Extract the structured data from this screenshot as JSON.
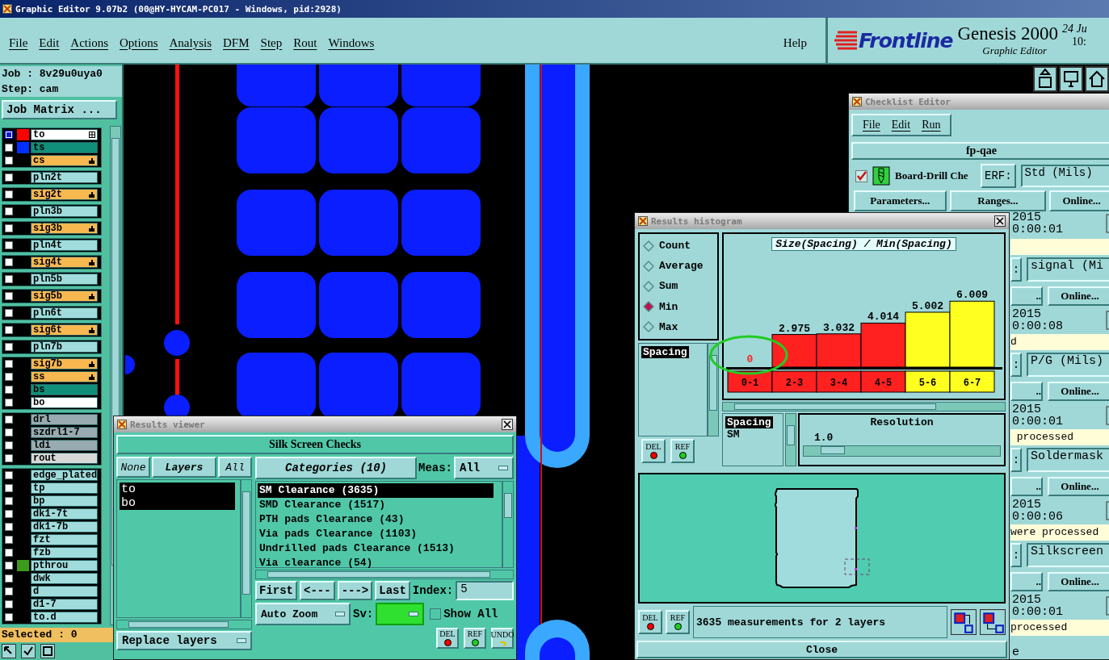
{
  "window": {
    "title": "Graphic Editor 9.07b2 (00@HY-HYCAM-PC017 - Windows, pid:2928)"
  },
  "menu": [
    "File",
    "Edit",
    "Actions",
    "Options",
    "Analysis",
    "DFM",
    "Step",
    "Rout",
    "Windows"
  ],
  "help": "Help",
  "brand": {
    "logo": "Frontline",
    "product": "Genesis 2000",
    "subtitle": "Graphic Editor",
    "date": "24 Ju",
    "time": "10:"
  },
  "job": {
    "job": "Job : 8v29u0uya0",
    "step": "Step: cam",
    "matrix_button": "Job Matrix ..."
  },
  "layer_groups": [
    {
      "layers": [
        {
          "name": "to",
          "color": "#ffffff",
          "swatch": {
            "color": "#ff0000"
          },
          "selected": true,
          "kind": "grid"
        },
        {
          "name": "ts",
          "color": "#10907a",
          "swatch": {
            "color": "#0030ff"
          },
          "selected": false,
          "kind": "plain"
        },
        {
          "name": "cs",
          "color": "#f8b850",
          "selected": false,
          "kind": "hand"
        }
      ]
    },
    {
      "layers": [
        {
          "name": "pln2t",
          "color": "#a0dcdc",
          "selected": false,
          "kind": "plain"
        }
      ]
    },
    {
      "layers": [
        {
          "name": "sig2t",
          "color": "#f8b850",
          "selected": false,
          "kind": "hand"
        }
      ]
    },
    {
      "layers": [
        {
          "name": "pln3b",
          "color": "#a0dcdc",
          "selected": false,
          "kind": "plain"
        }
      ]
    },
    {
      "layers": [
        {
          "name": "sig3b",
          "color": "#f8b850",
          "selected": false,
          "kind": "hand"
        }
      ]
    },
    {
      "layers": [
        {
          "name": "pln4t",
          "color": "#a0dcdc",
          "selected": false,
          "kind": "plain"
        }
      ]
    },
    {
      "layers": [
        {
          "name": "sig4t",
          "color": "#f8b850",
          "selected": false,
          "kind": "hand"
        }
      ]
    },
    {
      "layers": [
        {
          "name": "pln5b",
          "color": "#a0dcdc",
          "selected": false,
          "kind": "plain"
        }
      ]
    },
    {
      "layers": [
        {
          "name": "sig5b",
          "color": "#f8b850",
          "selected": false,
          "kind": "hand"
        }
      ]
    },
    {
      "layers": [
        {
          "name": "pln6t",
          "color": "#a0dcdc",
          "selected": false,
          "kind": "plain"
        }
      ]
    },
    {
      "layers": [
        {
          "name": "sig6t",
          "color": "#f8b850",
          "selected": false,
          "kind": "hand"
        }
      ]
    },
    {
      "layers": [
        {
          "name": "pln7b",
          "color": "#a0dcdc",
          "selected": false,
          "kind": "plain"
        }
      ]
    },
    {
      "layers": [
        {
          "name": "sig7b",
          "color": "#f8b850",
          "selected": false,
          "kind": "hand"
        },
        {
          "name": "ss",
          "color": "#f8b850",
          "selected": false,
          "kind": "hand"
        },
        {
          "name": "bs",
          "color": "#10907a",
          "selected": false,
          "kind": "plain"
        },
        {
          "name": "bo",
          "color": "#ffffff",
          "selected": false,
          "kind": "plain"
        }
      ]
    },
    {
      "layers": [
        {
          "name": "drl",
          "color": "#98abb0",
          "selected": false,
          "kind": "plain"
        },
        {
          "name": "szdrl1-7",
          "color": "#98abb0",
          "selected": false,
          "kind": "plain"
        },
        {
          "name": "ldi",
          "color": "#98abb0",
          "selected": false,
          "kind": "plain"
        },
        {
          "name": "rout",
          "color": "#d8d8d8",
          "selected": false,
          "kind": "plain"
        }
      ]
    },
    {
      "layers": [
        {
          "name": "edge_plated",
          "color": "#a0dcdc",
          "selected": false,
          "kind": "plain"
        },
        {
          "name": "tp",
          "color": "#a0dcdc",
          "selected": false,
          "kind": "plain"
        },
        {
          "name": "bp",
          "color": "#a0dcdc",
          "selected": false,
          "kind": "plain"
        },
        {
          "name": "dk1-7t",
          "color": "#a0dcdc",
          "selected": false,
          "kind": "plain"
        },
        {
          "name": "dk1-7b",
          "color": "#a0dcdc",
          "selected": false,
          "kind": "plain"
        },
        {
          "name": "fzt",
          "color": "#a0dcdc",
          "selected": false,
          "kind": "plain"
        },
        {
          "name": "fzb",
          "color": "#a0dcdc",
          "selected": false,
          "kind": "plain"
        },
        {
          "name": "pthrou",
          "color": "#a0dcdc",
          "swatch": {
            "color": "#3c9a1c"
          },
          "selected": false,
          "kind": "plain"
        },
        {
          "name": "dwk",
          "color": "#a0dcdc",
          "selected": false,
          "kind": "plain"
        },
        {
          "name": "d",
          "color": "#a0dcdc",
          "selected": false,
          "kind": "plain"
        },
        {
          "name": "d1-7",
          "color": "#a0dcdc",
          "selected": false,
          "kind": "plain"
        },
        {
          "name": "to.d",
          "color": "#a0dcdc",
          "selected": false,
          "kind": "plain"
        }
      ]
    }
  ],
  "selected_count": "Selected : 0",
  "checklist": {
    "title": "Checklist Editor",
    "menu": [
      "File",
      "Edit",
      "Run"
    ],
    "name": "fp-qae",
    "check": {
      "checked": true,
      "name": "Board-Drill Che",
      "erf": "ERF:",
      "field": "Std (Mils)"
    },
    "buttons": [
      "Parameters...",
      "Ranges...",
      "Online..."
    ],
    "first_run": {
      "year": "2015",
      "time": "0:00:01"
    },
    "sections": [
      {
        "erf": ":",
        "field": "signal (Mi",
        "ranges": "..",
        "online": "Online...",
        "year": "2015",
        "time": "0:00:08",
        "status": "d"
      },
      {
        "erf": ":",
        "field": "P/G (Mils)",
        "ranges": "..",
        "online": "Online...",
        "year": "2015",
        "time": "0:00:01",
        "status": " processed"
      },
      {
        "erf": ":",
        "field": "Soldermask",
        "ranges": "..",
        "online": "Online...",
        "year": "2015",
        "time": "0:00:06",
        "status": "were processed"
      },
      {
        "erf": ":",
        "field": "Silkscreen",
        "ranges": "..",
        "online": "Online...",
        "year": "2015",
        "time": "0:00:01",
        "status": "processed"
      }
    ],
    "footer": "e"
  },
  "histogram": {
    "title": "Results histogram",
    "modes": [
      {
        "label": "Count",
        "selected": false
      },
      {
        "label": "Average",
        "selected": false
      },
      {
        "label": "Sum",
        "selected": false
      },
      {
        "label": "Min",
        "selected": true
      },
      {
        "label": "Max",
        "selected": false
      }
    ],
    "measures": [
      {
        "label": "Spacing",
        "selected": true
      }
    ],
    "left_buttons": [
      {
        "label": "DEL",
        "kind": "dot",
        "color": "#ee0000"
      },
      {
        "label": "REF",
        "kind": "dot",
        "color": "#22cc22"
      }
    ],
    "chart_data": {
      "type": "bar",
      "title": "Size(Spacing) / Min(Spacing)",
      "categories": [
        "0-1",
        "2-3",
        "3-4",
        "4-5",
        "5-6",
        "6-7"
      ],
      "series": [
        {
          "color": "#ff2020",
          "values": [
            0,
            2.975,
            3.032,
            4.014,
            null,
            null
          ]
        },
        {
          "color": "#ffff20",
          "values": [
            null,
            null,
            null,
            null,
            5.002,
            6.009
          ]
        }
      ],
      "data_labels": true
    },
    "filters": [
      {
        "label": "Spacing",
        "selected": true
      },
      {
        "label": "SM",
        "selected": false
      }
    ],
    "resolution": {
      "label": "Resolution",
      "value": "1.0",
      "level": 0.1
    },
    "bottom_buttons": [
      {
        "label": "DEL",
        "kind": "dot",
        "color": "#ee0000"
      },
      {
        "label": "REF",
        "kind": "dot",
        "color": "#22cc22"
      }
    ],
    "message": "3635 measurements for 2 layers",
    "close": "Close"
  },
  "results_viewer": {
    "title": "Results viewer",
    "header": "Silk Screen Checks",
    "layer_buttons": [
      "None",
      "Layers",
      "All"
    ],
    "layers": [
      {
        "name": "to",
        "selected": true
      },
      {
        "name": "bo",
        "selected": true
      }
    ],
    "replace": "Replace layers",
    "categories_button": "Categories (10)",
    "meas_label": "Meas:",
    "meas_value": "All",
    "categories": [
      {
        "label": "SM Clearance (3635)",
        "selected": true
      },
      {
        "label": "SMD Clearance (1517)",
        "selected": false
      },
      {
        "label": "PTH pads Clearance (43)",
        "selected": false
      },
      {
        "label": "Via pads Clearance (1103)",
        "selected": false
      },
      {
        "label": "Undrilled pads Clearance (1513)",
        "selected": false
      },
      {
        "label": "Via clearance (54)",
        "selected": false
      }
    ],
    "nav": [
      "First",
      "<---",
      "--->",
      "Last"
    ],
    "index_label": "Index:",
    "index_value": "5",
    "zoom": "Auto Zoom",
    "sv_label": "Sv:",
    "show_all": {
      "label": "Show All",
      "checked": false
    },
    "actions": [
      {
        "label": "DEL",
        "kind": "dot",
        "color": "#ee0000"
      },
      {
        "label": "REF",
        "kind": "dot",
        "color": "#22cc22"
      },
      {
        "label": "UNDO",
        "kind": "undo",
        "color": "#e0c000"
      }
    ]
  }
}
